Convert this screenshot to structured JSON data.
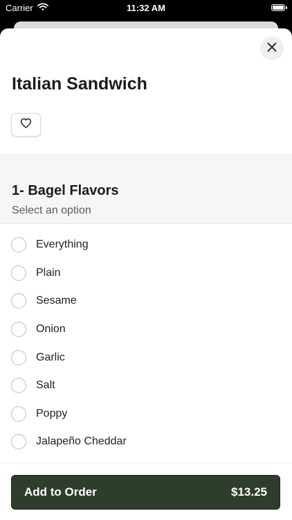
{
  "status_bar": {
    "carrier": "Carrier",
    "time": "11:32 AM",
    "wifi_icon": "wifi-icon",
    "battery_icon": "battery-icon"
  },
  "item": {
    "title": "Italian Sandwich",
    "favorite_icon": "heart-icon",
    "close_icon": "close-icon"
  },
  "section": {
    "title": "1- Bagel Flavors",
    "subtitle": "Select an option",
    "options": [
      {
        "label": "Everything",
        "selected": false
      },
      {
        "label": "Plain",
        "selected": false
      },
      {
        "label": "Sesame",
        "selected": false
      },
      {
        "label": "Onion",
        "selected": false
      },
      {
        "label": "Garlic",
        "selected": false
      },
      {
        "label": "Salt",
        "selected": false
      },
      {
        "label": "Poppy",
        "selected": false
      },
      {
        "label": "Jalapeño Cheddar",
        "selected": false
      }
    ]
  },
  "footer": {
    "add_label": "Add to Order",
    "price": "$13.25"
  },
  "colors": {
    "primary_button": "#2f3d2c",
    "section_background": "#f6f6f6",
    "radio_border": "#bdbdbd"
  }
}
